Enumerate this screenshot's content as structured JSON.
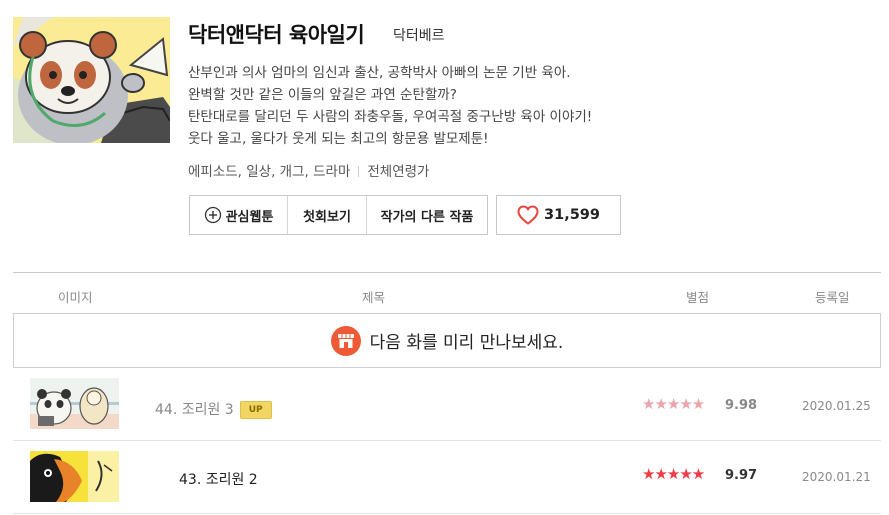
{
  "webtoon": {
    "title": "닥터앤닥터 육아일기",
    "author": "닥터베르",
    "description_lines": [
      "산부인과 의사 엄마의 임신과 출산, 공학박사 아빠의 논문 기반 육아.",
      "완벽할 것만 같은 이들의 앞길은 과연 순탄할까?",
      "탄탄대로를 달리던 두 사람의 좌충우돌, 우여곡절 중구난방 육아 이야기!",
      "웃다 울고, 울다가 웃게 되는 최고의 항문용 발모제툰!"
    ],
    "genres": "에피소드, 일상, 개그, 드라마",
    "age_rating": "전체연령가"
  },
  "actions": {
    "favorite_label": "관심웹툰",
    "first_episode_label": "첫회보기",
    "other_works_label": "작가의 다른 작품",
    "like_count": "31,599"
  },
  "table": {
    "headers": {
      "image": "이미지",
      "title": "제목",
      "rating": "별점",
      "date": "등록일"
    }
  },
  "preview_banner": {
    "text": "다음 화를 미리 만나보세요."
  },
  "episodes": [
    {
      "title": "44. 조리원 3",
      "badge": "UP",
      "stars": "★★★★★",
      "rating": 9.98,
      "rating_text": "9.98",
      "date": "2020.01.25",
      "muted": true
    },
    {
      "title": "43. 조리원 2",
      "badge": "",
      "stars": "★★★★★",
      "rating": 9.97,
      "rating_text": "9.97",
      "date": "2020.01.21",
      "muted": false
    }
  ],
  "icons": {
    "favorite": "plus-circle-icon",
    "like": "heart-icon",
    "preview": "store-icon"
  },
  "colors": {
    "heart": "#e8463d",
    "store_badge": "#ef5a36",
    "star_active": "#ef3b45",
    "star_muted": "#e9a6aa",
    "up_badge": "#f2d664"
  }
}
